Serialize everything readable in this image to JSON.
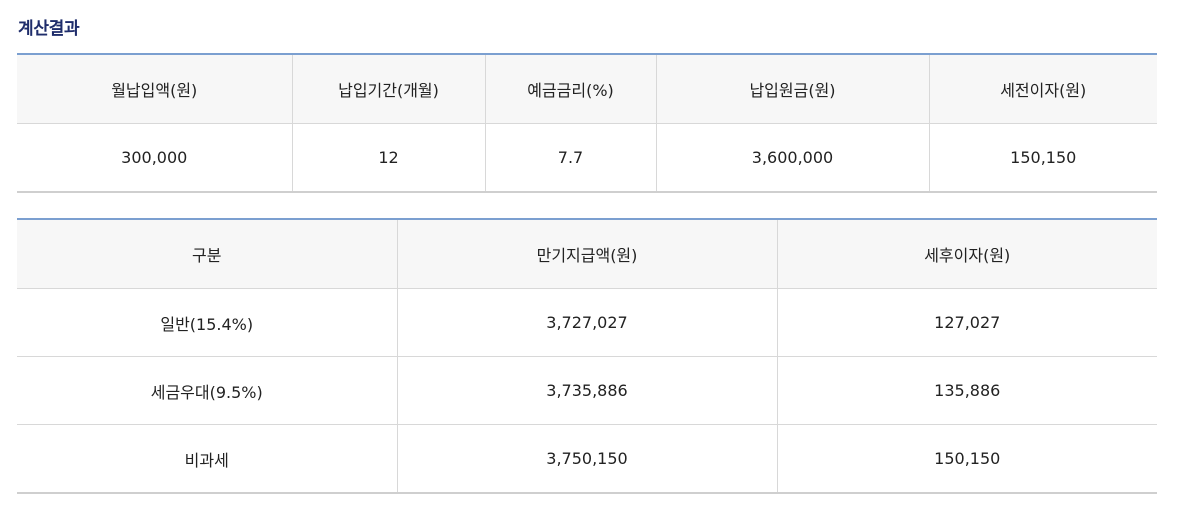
{
  "title": "계산결과",
  "summary_table": {
    "headers": [
      "월납입액(원)",
      "납입기간(개월)",
      "예금금리(%)",
      "납입원금(원)",
      "세전이자(원)"
    ],
    "row": [
      "300,000",
      "12",
      "7.7",
      "3,600,000",
      "150,150"
    ]
  },
  "detail_table": {
    "headers": [
      "구분",
      "만기지급액(원)",
      "세후이자(원)"
    ],
    "rows": [
      [
        "일반(15.4%)",
        "3,727,027",
        "127,027"
      ],
      [
        "세금우대(9.5%)",
        "3,735,886",
        "135,886"
      ],
      [
        "비과세",
        "3,750,150",
        "150,150"
      ]
    ]
  }
}
